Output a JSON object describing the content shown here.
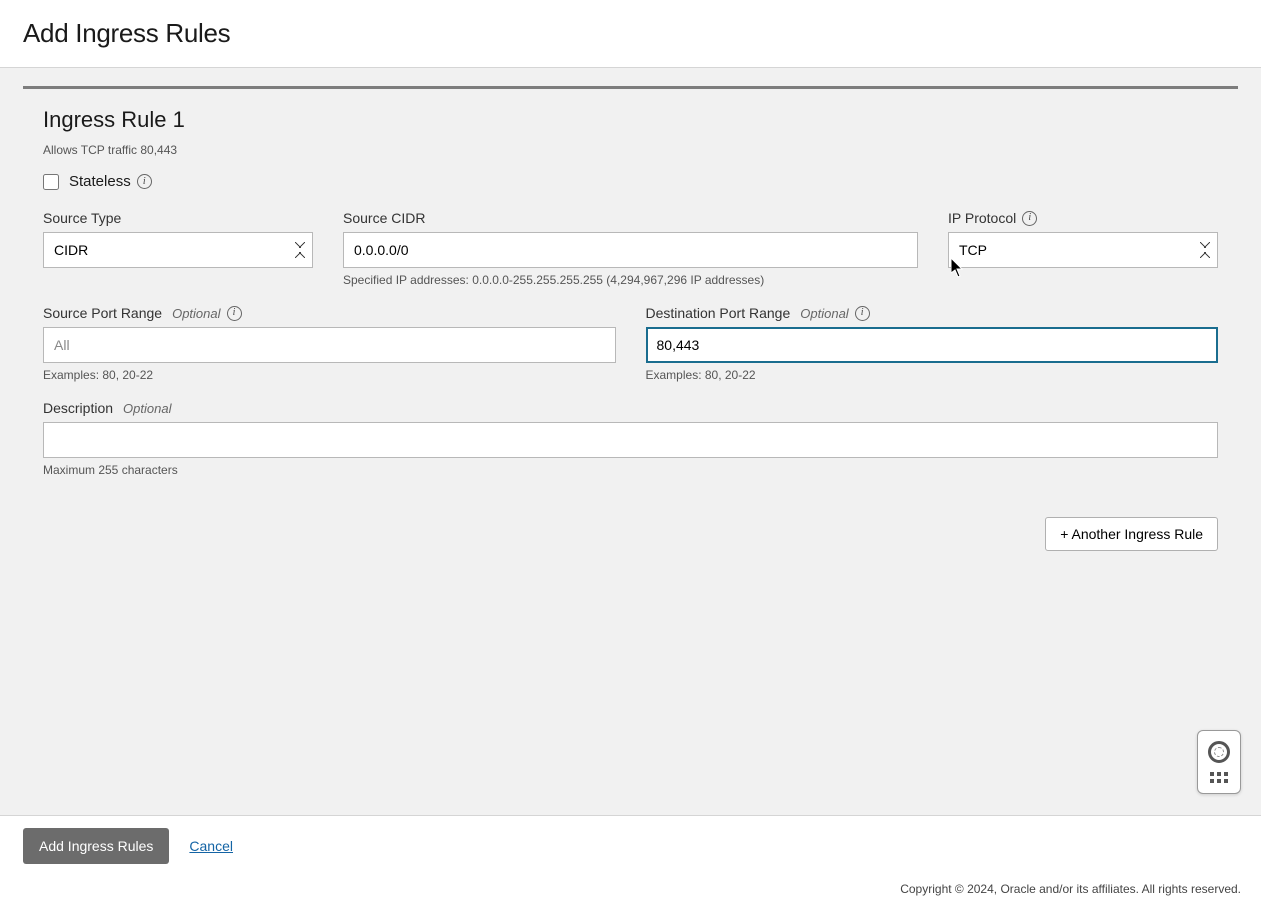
{
  "header": {
    "title": "Add Ingress Rules"
  },
  "rule": {
    "title": "Ingress Rule 1",
    "subtitle": "Allows TCP traffic 80,443",
    "stateless_label": "Stateless",
    "source_type": {
      "label": "Source Type",
      "value": "CIDR"
    },
    "source_cidr": {
      "label": "Source CIDR",
      "value": "0.0.0.0/0",
      "helper": "Specified IP addresses: 0.0.0.0-255.255.255.255 (4,294,967,296 IP addresses)"
    },
    "ip_protocol": {
      "label": "IP Protocol",
      "value": "TCP"
    },
    "source_port": {
      "label": "Source Port Range",
      "optional": "Optional",
      "placeholder": "All",
      "value": "",
      "helper": "Examples: 80, 20-22"
    },
    "dest_port": {
      "label": "Destination Port Range",
      "optional": "Optional",
      "value": "80,443",
      "helper": "Examples: 80, 20-22"
    },
    "description": {
      "label": "Description",
      "optional": "Optional",
      "value": "",
      "helper": "Maximum 255 characters"
    }
  },
  "buttons": {
    "add_another": "+ Another Ingress Rule",
    "submit": "Add Ingress Rules",
    "cancel": "Cancel"
  },
  "footer": {
    "copyright": "Copyright © 2024, Oracle and/or its affiliates. All rights reserved."
  }
}
